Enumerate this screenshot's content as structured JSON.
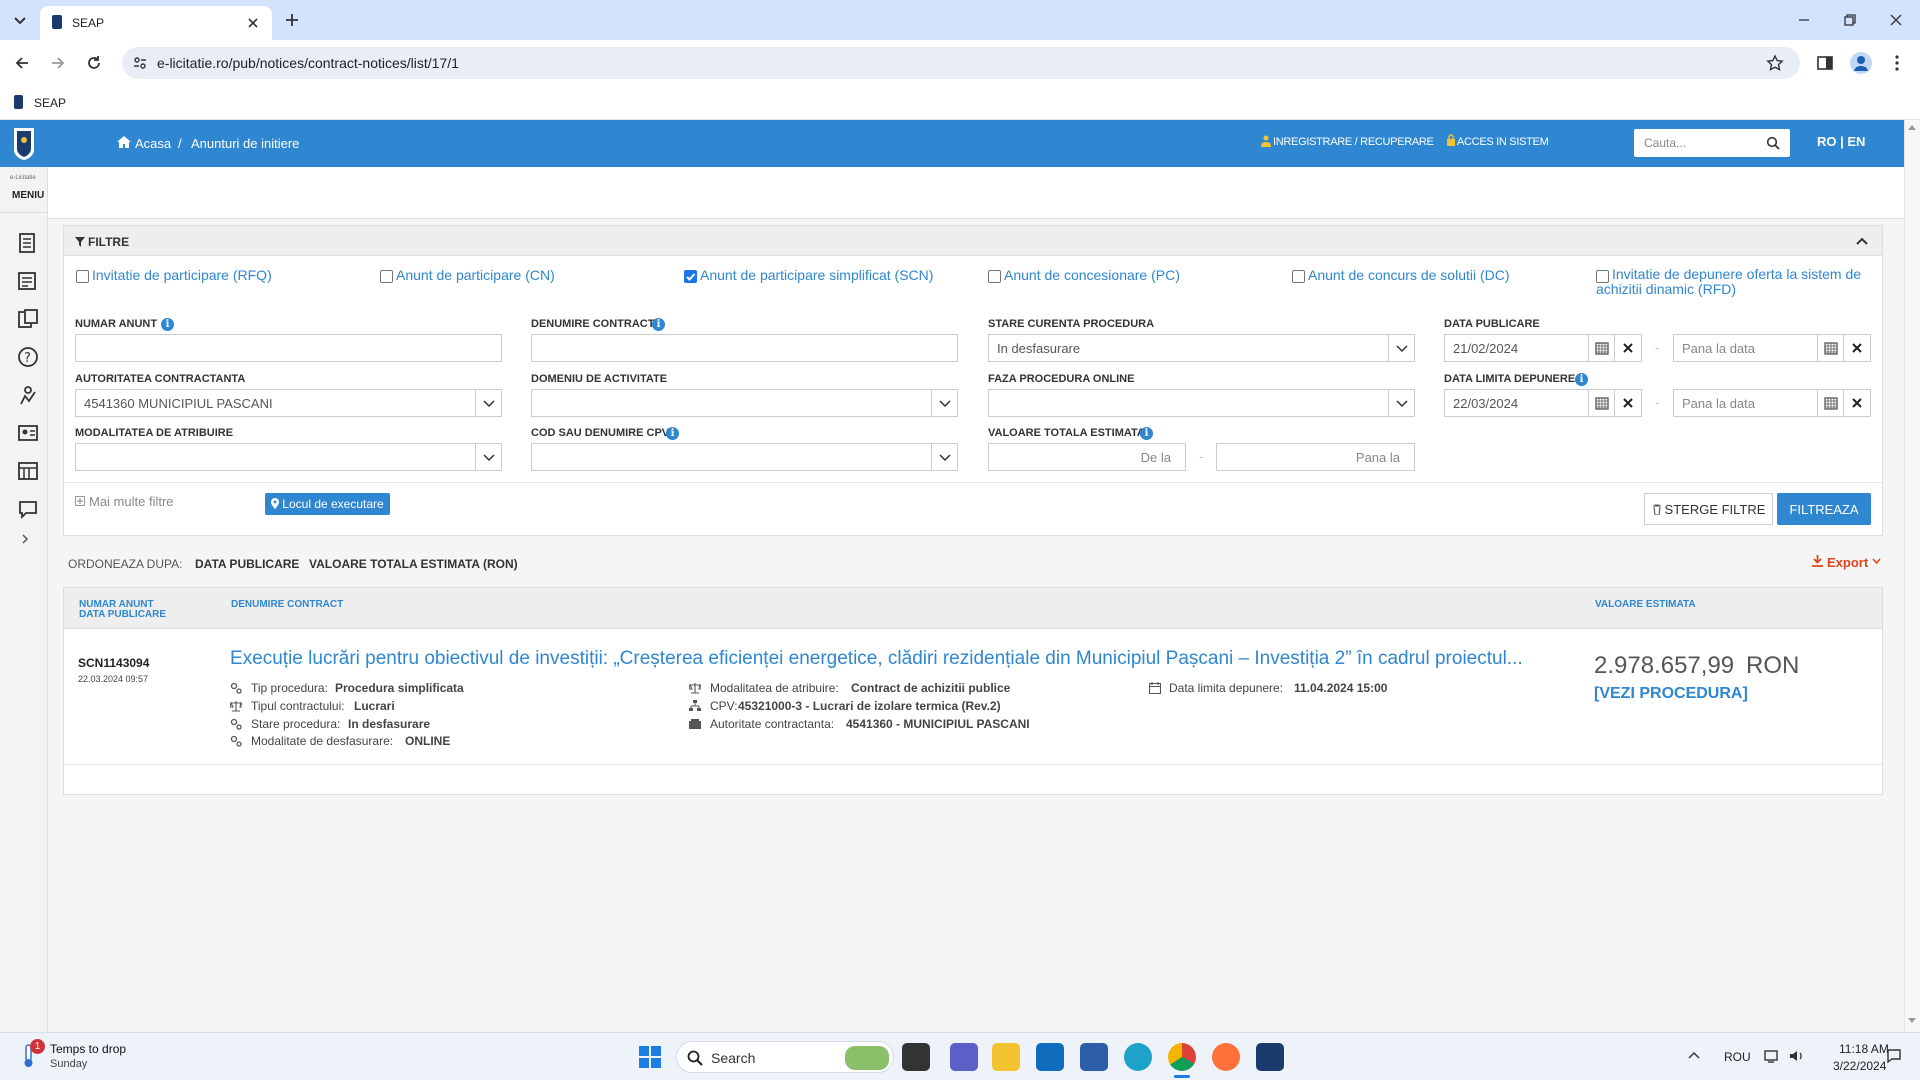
{
  "browser": {
    "tab_title": "SEAP",
    "url": "e-licitatie.ro/pub/notices/contract-notices/list/17/1",
    "bookmark_label": "SEAP"
  },
  "header": {
    "breadcrumb_home": "Acasa",
    "breadcrumb_sep": "/",
    "breadcrumb_current": "Anunturi de initiere",
    "register_label": "INREGISTRARE / RECUPERARE",
    "login_label": "ACCES IN SISTEM",
    "search_placeholder": "Cauta...",
    "lang": "RO | EN"
  },
  "leftnav": {
    "brand": "e-Licitatie",
    "menu_label": "MENIU"
  },
  "filters": {
    "title": "FILTRE",
    "types": [
      {
        "label": "Invitatie de participare (RFQ)",
        "checked": false
      },
      {
        "label": "Anunt de participare (CN)",
        "checked": false
      },
      {
        "label": "Anunt de participare simplificat (SCN)",
        "checked": true
      },
      {
        "label": "Anunt de concesionare (PC)",
        "checked": false
      },
      {
        "label": "Anunt de concurs de solutii (DC)",
        "checked": false
      },
      {
        "label": "Invitatie de depunere oferta la sistem de achizitii dinamic (RFD)",
        "checked": false
      }
    ],
    "labels": {
      "numar_anunt": "NUMAR ANUNT",
      "denumire_contract": "DENUMIRE CONTRACT",
      "stare_curenta": "STARE CURENTA PROCEDURA",
      "data_publicare": "DATA PUBLICARE",
      "autoritatea": "AUTORITATEA CONTRACTANTA",
      "domeniu": "DOMENIU DE ACTIVITATE",
      "faza": "FAZA PROCEDURA ONLINE",
      "data_limita": "DATA LIMITA DEPUNERE",
      "modalitatea": "MODALITATEA DE ATRIBUIRE",
      "cpv": "COD SAU DENUMIRE CPV",
      "valoare": "VALOARE TOTALA ESTIMATA"
    },
    "values": {
      "stare_curenta": "In desfasurare",
      "data_publicare_from": "21/02/2024",
      "data_publicare_to_placeholder": "Pana la data",
      "autoritatea": "4541360 MUNICIPIUL PASCANI",
      "data_limita_from": "22/03/2024",
      "data_limita_to_placeholder": "Pana la data",
      "valoare_from_placeholder": "De la",
      "valoare_to_placeholder": "Pana la",
      "range_sep": "-"
    },
    "more_filters": "Mai multe filtre",
    "locul_btn": "Locul de executare",
    "clear_btn": "STERGE FILTRE",
    "apply_btn": "FILTREAZA"
  },
  "sort": {
    "label": "ORDONEAZA DUPA:",
    "opt1": "DATA PUBLICARE",
    "opt2": "VALOARE TOTALA ESTIMATA (RON)",
    "export": "Export"
  },
  "results": {
    "col1_line1": "NUMAR ANUNT",
    "col1_line2": "DATA PUBLICARE",
    "col2": "DENUMIRE CONTRACT",
    "col3": "VALOARE ESTIMATA",
    "items": [
      {
        "number": "SCN1143094",
        "date": "22.03.2024 09:57",
        "title": "Execuție lucrări pentru obiectivul de investiții: „Creșterea eficienței energetice, clădiri rezidențiale din Municipiul Pașcani – Investiția 2” în cadrul proiectul...",
        "tip_procedura_label": "Tip procedura:",
        "tip_procedura": "Procedura simplificata",
        "tip_contract_label": "Tipul contractului:",
        "tip_contract": "Lucrari",
        "stare_label": "Stare procedura:",
        "stare": "In desfasurare",
        "modalitate_desf_label": "Modalitate de desfasurare:",
        "modalitate_desf": "ONLINE",
        "modalitatea_atr_label": "Modalitatea de atribuire:",
        "modalitatea_atr": "Contract de achizitii publice",
        "cpv_label": "CPV:",
        "cpv": "45321000-3 - Lucrari de izolare termica (Rev.2)",
        "autoritate_label": "Autoritate contractanta:",
        "autoritate": "4541360 - MUNICIPIUL PASCANI",
        "data_limita_label": "Data limita depunere:",
        "data_limita": "11.04.2024 15:00",
        "value": "2.978.657,99",
        "currency": "RON",
        "view_link": "[VEZI PROCEDURA]"
      }
    ]
  },
  "taskbar": {
    "weather_title": "Temps to drop",
    "weather_sub": "Sunday",
    "weather_badge": "1",
    "search_label": "Search",
    "lang": "ROU",
    "time": "11:18 AM",
    "date": "3/22/2024"
  },
  "colors": {
    "brand": "#2f86d1",
    "taskbar": "#eef3fa",
    "tabstrip": "#d3e3fd"
  }
}
